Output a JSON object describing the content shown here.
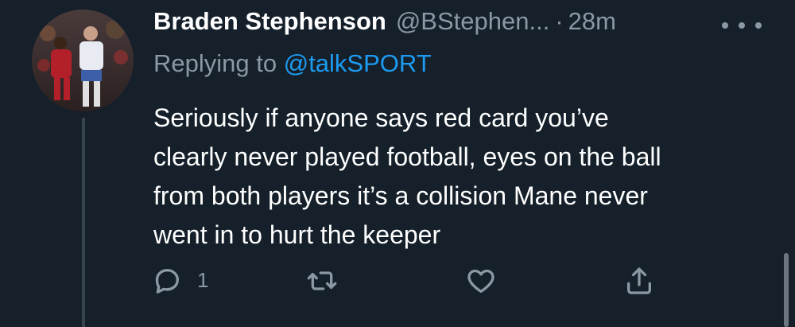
{
  "tweet": {
    "author_name": "Braden Stephenson",
    "author_handle": "@BStephen...",
    "separator": "·",
    "time": "28m",
    "replying_prefix": "Replying to",
    "replying_to": "@talkSPORT",
    "text": "Seriously if anyone says red card you’ve\nclearly never played football, eyes on the ball\nfrom both players it’s a collision Mane never\nwent in to hurt the keeper",
    "reply_count": "1"
  },
  "icons": {
    "reply": "reply-icon",
    "retweet": "retweet-icon",
    "like": "heart-icon",
    "share": "share-icon",
    "more": "more-options-icon"
  },
  "colors": {
    "background": "#15202b",
    "text": "#ffffff",
    "muted": "#8b98a5",
    "link": "#1d9bf0",
    "thread_line": "#38444d"
  }
}
